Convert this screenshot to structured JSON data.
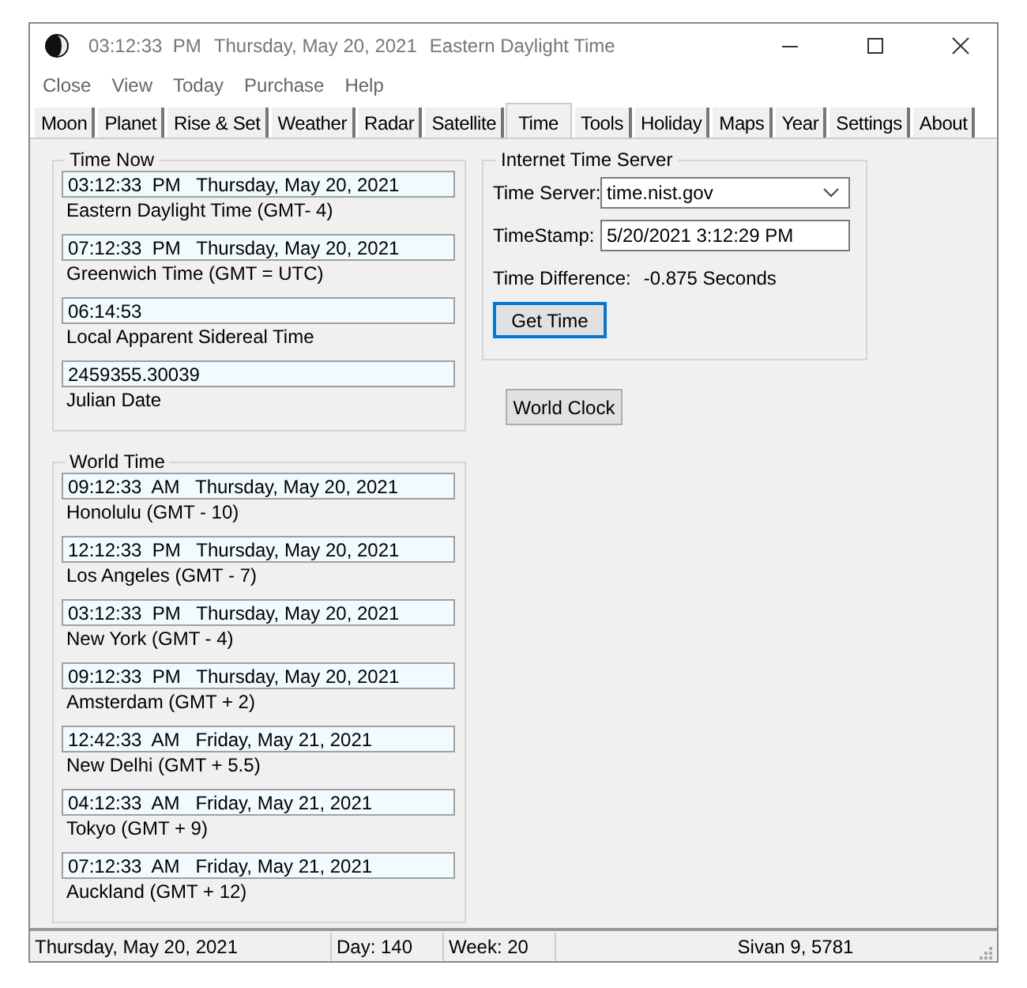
{
  "title_bar": {
    "time": "03:12:33  PM",
    "date": "Thursday, May 20, 2021",
    "zone": "Eastern Daylight Time"
  },
  "menu": [
    "Close",
    "View",
    "Today",
    "Purchase",
    "Help"
  ],
  "tabs": [
    {
      "label": "Moon",
      "selected": false
    },
    {
      "label": "Planet",
      "selected": false
    },
    {
      "label": "Rise & Set",
      "selected": false
    },
    {
      "label": "Weather",
      "selected": false
    },
    {
      "label": "Radar",
      "selected": false
    },
    {
      "label": "Satellite",
      "selected": false
    },
    {
      "label": "Time",
      "selected": true
    },
    {
      "label": "Tools",
      "selected": false
    },
    {
      "label": "Holiday",
      "selected": false
    },
    {
      "label": "Maps",
      "selected": false
    },
    {
      "label": "Year",
      "selected": false
    },
    {
      "label": "Settings",
      "selected": false
    },
    {
      "label": "About",
      "selected": false
    }
  ],
  "time_now": {
    "title": "Time Now",
    "entries": [
      {
        "value": "03:12:33  PM   Thursday, May 20, 2021",
        "label": "Eastern Daylight Time (GMT- 4)"
      },
      {
        "value": "07:12:33  PM   Thursday, May 20, 2021",
        "label": "Greenwich Time (GMT = UTC)"
      },
      {
        "value": "06:14:53",
        "label": "Local Apparent Sidereal Time"
      },
      {
        "value": "2459355.30039",
        "label": "Julian Date"
      }
    ]
  },
  "world_time": {
    "title": "World Time",
    "entries": [
      {
        "value": "09:12:33  AM   Thursday, May 20, 2021",
        "label": "Honolulu (GMT - 10)"
      },
      {
        "value": "12:12:33  PM   Thursday, May 20, 2021",
        "label": "Los Angeles (GMT - 7)"
      },
      {
        "value": "03:12:33  PM   Thursday, May 20, 2021",
        "label": "New York (GMT - 4)"
      },
      {
        "value": "09:12:33  PM   Thursday, May 20, 2021",
        "label": "Amsterdam (GMT + 2)"
      },
      {
        "value": "12:42:33  AM   Friday, May 21, 2021",
        "label": "New Delhi (GMT + 5.5)"
      },
      {
        "value": "04:12:33  AM   Friday, May 21, 2021",
        "label": "Tokyo (GMT + 9)"
      },
      {
        "value": "07:12:33  AM   Friday, May 21, 2021",
        "label": "Auckland (GMT + 12)"
      }
    ]
  },
  "internet_time_server": {
    "title": "Internet Time Server",
    "time_server": {
      "label": "Time Server:",
      "value": "time.nist.gov"
    },
    "timestamp": {
      "label": "TimeStamp:",
      "value": "5/20/2021 3:12:29 PM"
    },
    "time_difference": {
      "label": "Time Difference:",
      "value": "-0.875 Seconds"
    },
    "button": "Get Time"
  },
  "world_clock_button": "World Clock",
  "status_bar": [
    "Thursday, May 20, 2021",
    "Day: 140",
    "Week: 20",
    "Sivan 9, 5781"
  ]
}
